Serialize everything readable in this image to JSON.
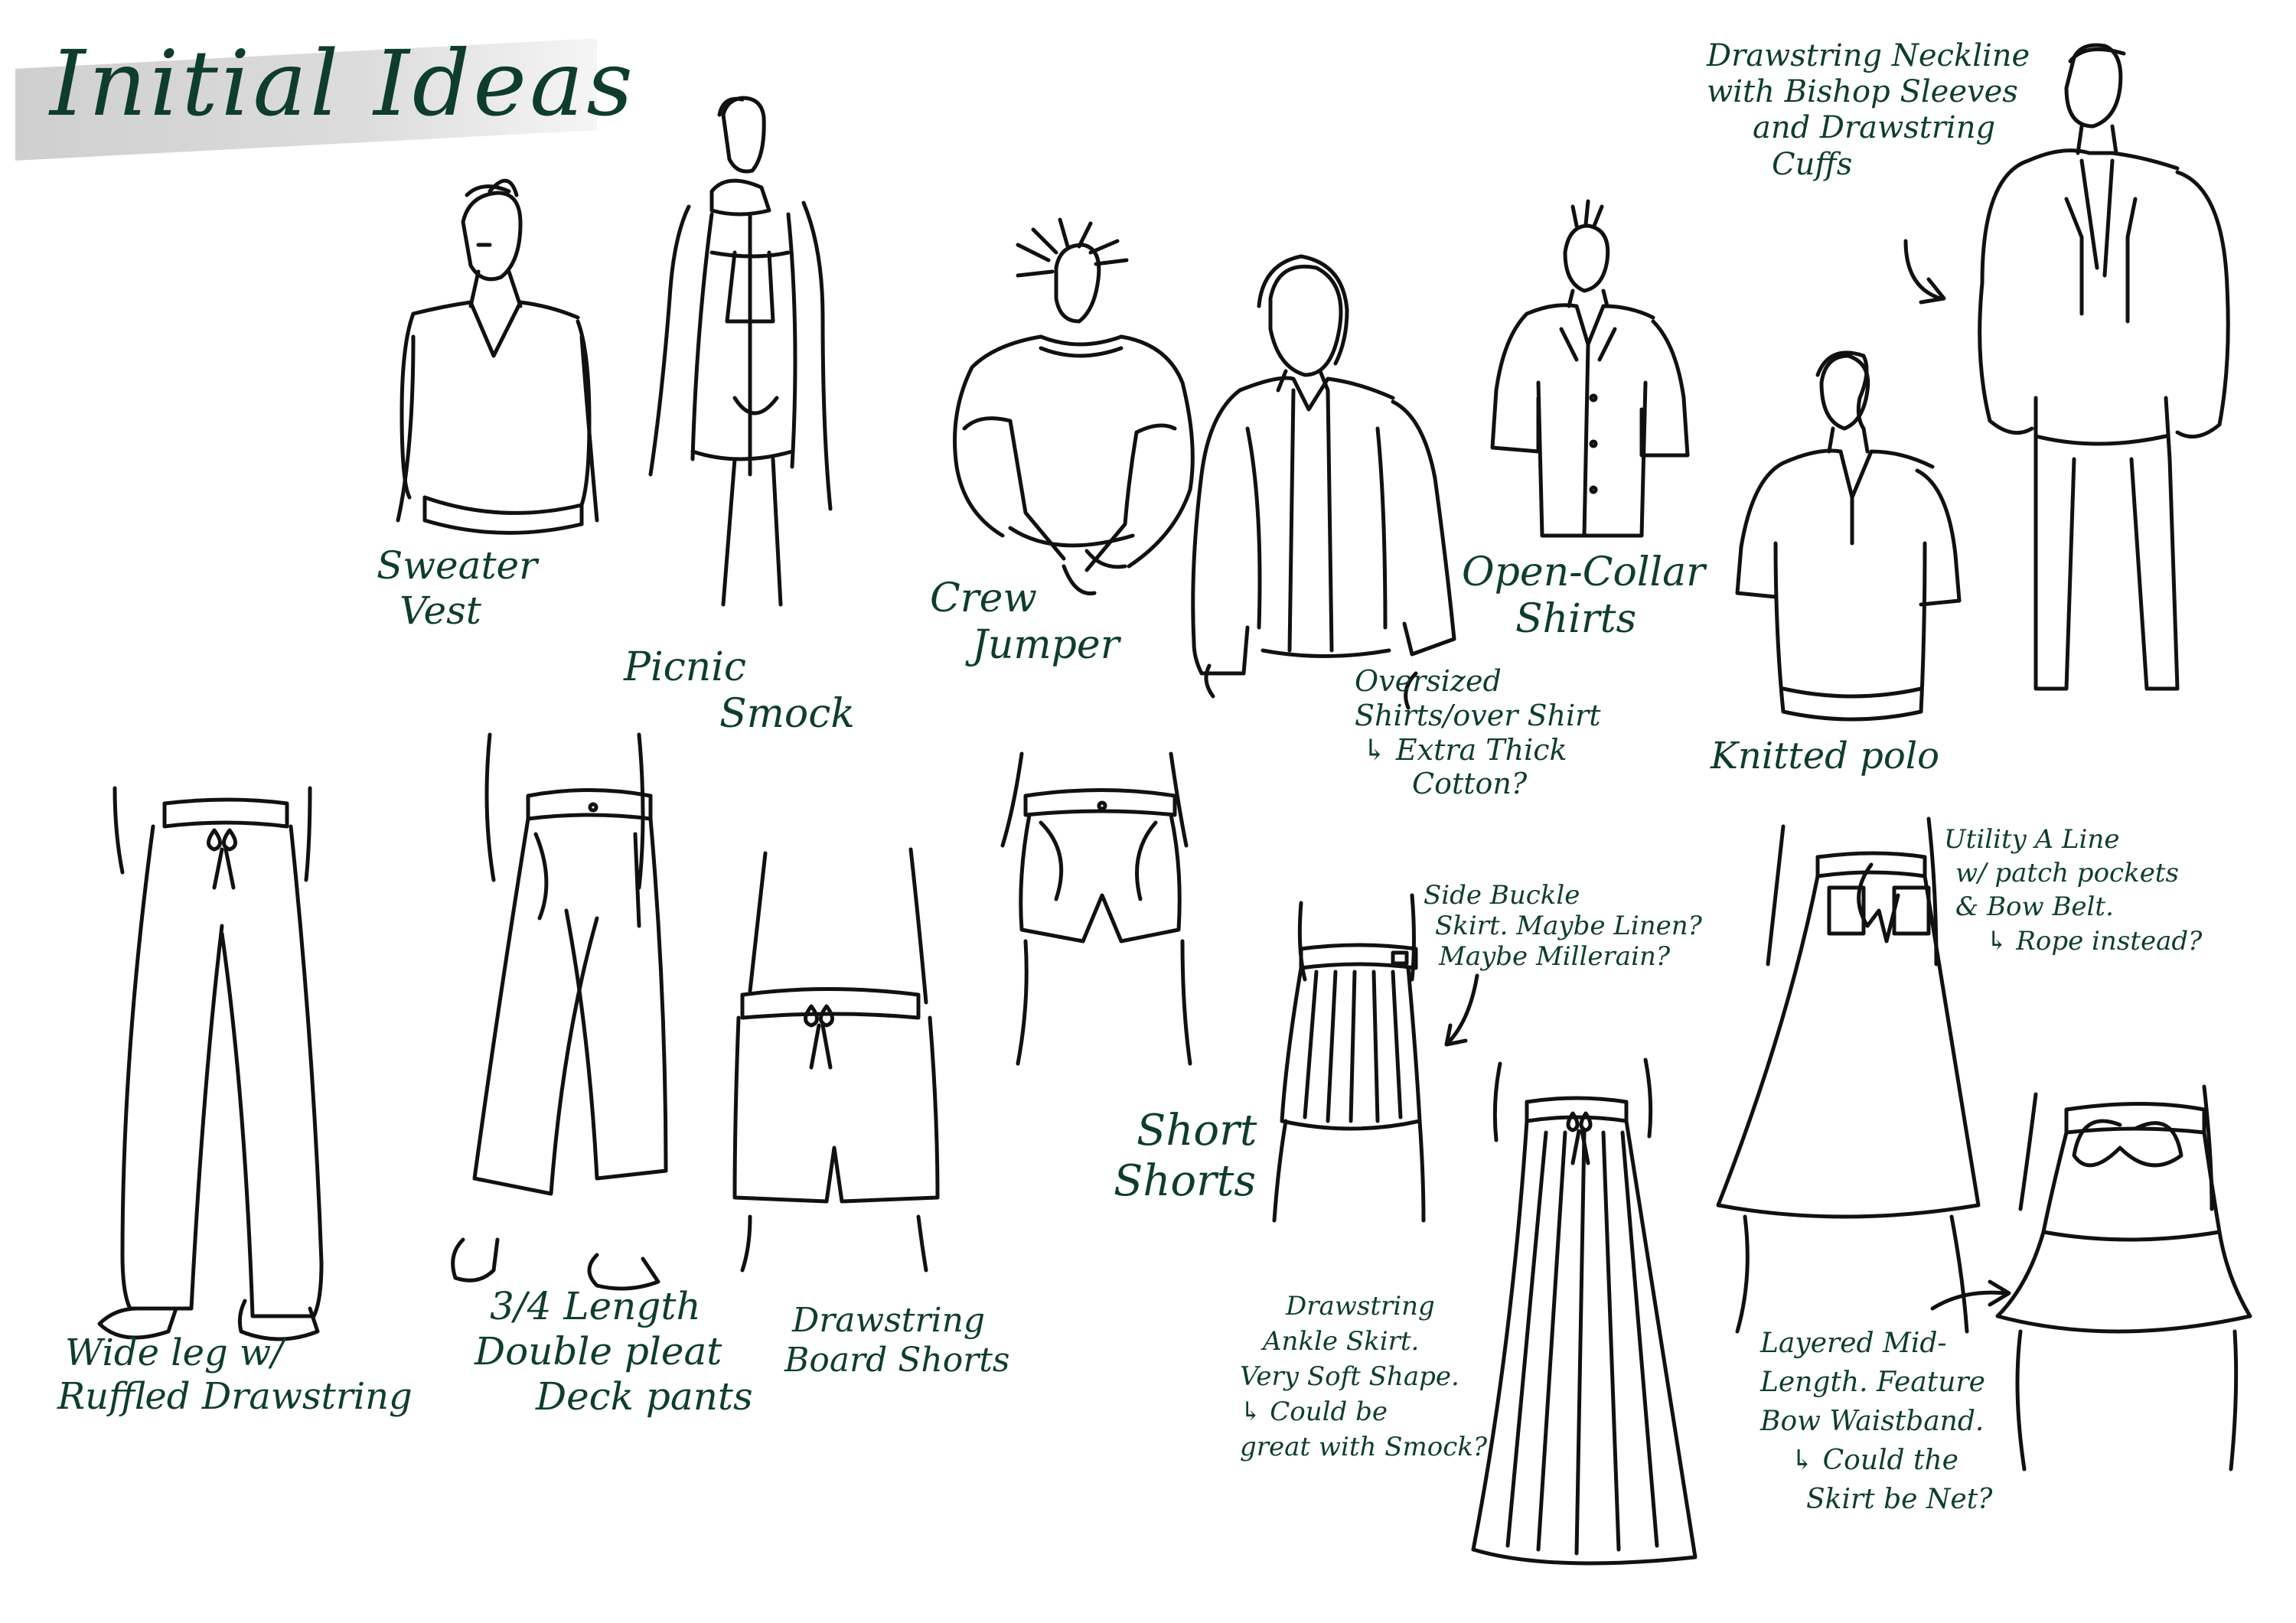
{
  "title": "Initial Ideas",
  "labels": {
    "sweater_vest": [
      "Sweater",
      "Vest"
    ],
    "picnic_smock": [
      "Picnic",
      "Smock"
    ],
    "crew_jumper": [
      "Crew",
      "Jumper"
    ],
    "oversized_shirts": [
      "Oversized",
      "Shirts/over Shirt",
      "↳ Extra Thick",
      "Cotton?"
    ],
    "open_collar_shirts": [
      "Open-Collar",
      "Shirts"
    ],
    "knitted_polo": "Knitted polo",
    "drawstring_neckline": [
      "Drawstring Neckline",
      "with Bishop Sleeves",
      "and Drawstring",
      "Cuffs"
    ],
    "wide_leg": [
      "Wide leg w/",
      "Ruffled Drawstring"
    ],
    "deck_pants": [
      "3/4 Length",
      "Double pleat",
      "Deck pants"
    ],
    "board_shorts": [
      "Drawstring",
      "Board Shorts"
    ],
    "short_shorts": [
      "Short",
      "Shorts"
    ],
    "side_buckle_skirt": [
      "Side Buckle",
      "Skirt. Maybe Linen?",
      "Maybe Millerain?"
    ],
    "ankle_skirt": [
      "Drawstring",
      "Ankle Skirt.",
      "Very Soft Shape.",
      "↳ Could be",
      "great with Smock?"
    ],
    "a_line_skirt": [
      "Utility A Line",
      "w/ patch pockets",
      "& Bow Belt.",
      "↳ Rope instead?"
    ],
    "layered_skirt": [
      "Layered Mid-",
      "Length. Feature",
      "Bow Waistband.",
      "↳ Could the",
      "Skirt be Net?"
    ]
  },
  "colors": {
    "ink": "#111111",
    "annotation": "#0e3d2e",
    "wash": "#d4d4d4"
  }
}
